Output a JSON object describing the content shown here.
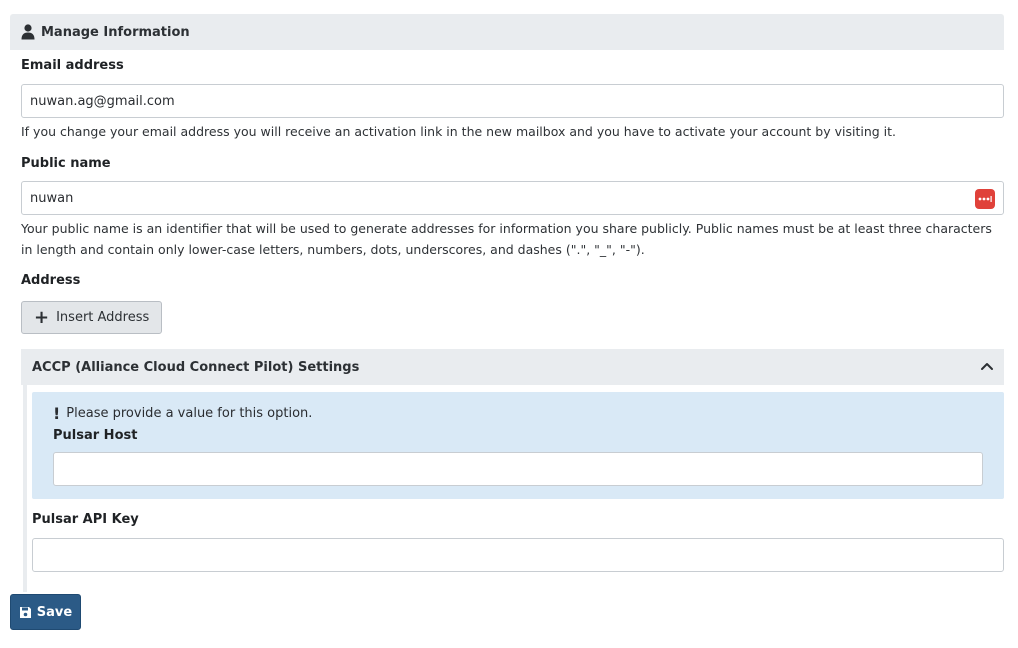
{
  "card": {
    "header_icon": "user-icon",
    "title": "Manage Information"
  },
  "email": {
    "label": "Email address",
    "value": "nuwan.ag@gmail.com",
    "help": "If you change your email address you will receive an activation link in the new mailbox and you have to activate your account by visiting it."
  },
  "public_name": {
    "label": "Public name",
    "value": "nuwan",
    "password_manager_icon": "password-manager-icon",
    "help": "Your public name is an identifier that will be used to generate addresses for information you share publicly. Public names must be at least three characters in length and contain only lower-case letters, numbers, dots, underscores, and dashes (\".\", \"_\", \"-\")."
  },
  "address": {
    "label": "Address",
    "insert_button": "Insert Address"
  },
  "accp": {
    "title": "ACCP (Alliance Cloud Connect Pilot) Settings",
    "collapse_icon": "chevron-up-icon",
    "alert": {
      "icon": "exclamation-icon",
      "message": "Please provide a value for this option."
    },
    "pulsar_host": {
      "label": "Pulsar Host",
      "value": ""
    },
    "pulsar_api_key": {
      "label": "Pulsar API Key",
      "value": ""
    }
  },
  "save_button": "Save",
  "colors": {
    "header_bg": "#e9ecef",
    "alert_bg": "#d9e9f6",
    "save_bg": "#2b5a86",
    "password_icon_bg": "#e0413a"
  }
}
